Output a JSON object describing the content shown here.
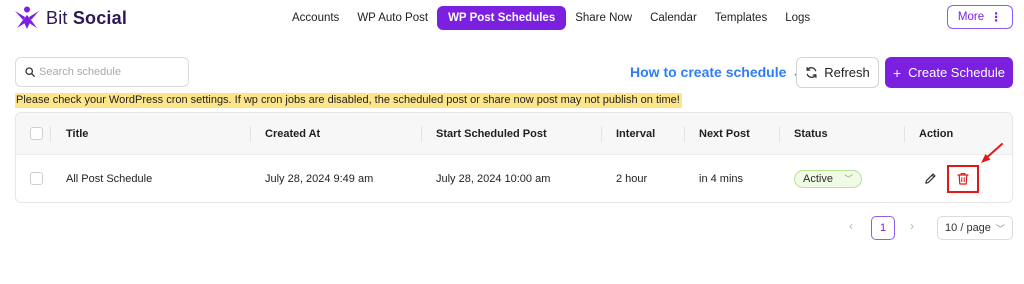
{
  "brand": {
    "name_light": "Bit",
    "name_bold": "Social",
    "color": "#7b1fe0"
  },
  "nav": {
    "items": [
      {
        "label": "Accounts",
        "active": false
      },
      {
        "label": "WP Auto Post",
        "active": false
      },
      {
        "label": "WP Post Schedules",
        "active": true
      },
      {
        "label": "Share Now",
        "active": false
      },
      {
        "label": "Calendar",
        "active": false
      },
      {
        "label": "Templates",
        "active": false
      },
      {
        "label": "Logs",
        "active": false
      }
    ],
    "more_label": "More",
    "more_icon": "vertical-dots-icon"
  },
  "toolbar": {
    "search_placeholder": "Search schedule",
    "search_value": "",
    "howto_label": "How to create schedule",
    "howto_icon": "external-arrow-icon",
    "refresh_label": "Refresh",
    "create_label": "Create Schedule"
  },
  "warning": {
    "text": "Please check your WordPress cron settings. If wp cron jobs are disabled, the scheduled post or share now post may not publish on time!",
    "background": "#fde68a"
  },
  "table": {
    "columns": [
      "Title",
      "Created At",
      "Start Scheduled Post",
      "Interval",
      "Next Post",
      "Status",
      "Action"
    ],
    "rows": [
      {
        "title": "All Post Schedule",
        "created_at": "July 28, 2024 9:49 am",
        "start_scheduled_post": "July 28, 2024 10:00 am",
        "interval": "2 hour",
        "next_post": "in 4 mins",
        "status": "Active",
        "actions": [
          "edit-icon",
          "delete-icon"
        ]
      }
    ]
  },
  "pagination": {
    "prev": "‹",
    "current_page": "1",
    "next": "›",
    "page_size": "10 / page"
  },
  "colors": {
    "accent": "#7b1fe0",
    "link": "#2f7df6",
    "danger": "#e01818",
    "status_bg": "#effbe4"
  }
}
